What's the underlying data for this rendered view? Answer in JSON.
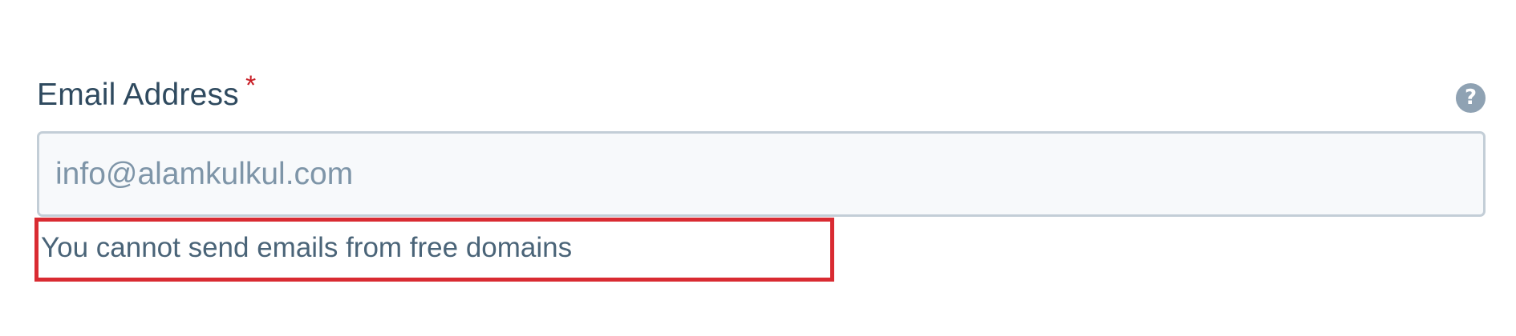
{
  "field": {
    "label": "Email Address",
    "required_marker": "*",
    "placeholder": "info@alamkulkul.com",
    "value": "",
    "help_icon": "question-circle-icon",
    "help_glyph": "?",
    "error_message": "You cannot send emails from free domains"
  },
  "colors": {
    "label": "#2f4a5f",
    "required": "#c81d25",
    "input_border": "#c3ced7",
    "input_background": "#f7f9fb",
    "placeholder": "#7e95a8",
    "error_text": "#4a6478",
    "highlight_box": "#d92b32",
    "help_icon": "#8fa2b3"
  }
}
